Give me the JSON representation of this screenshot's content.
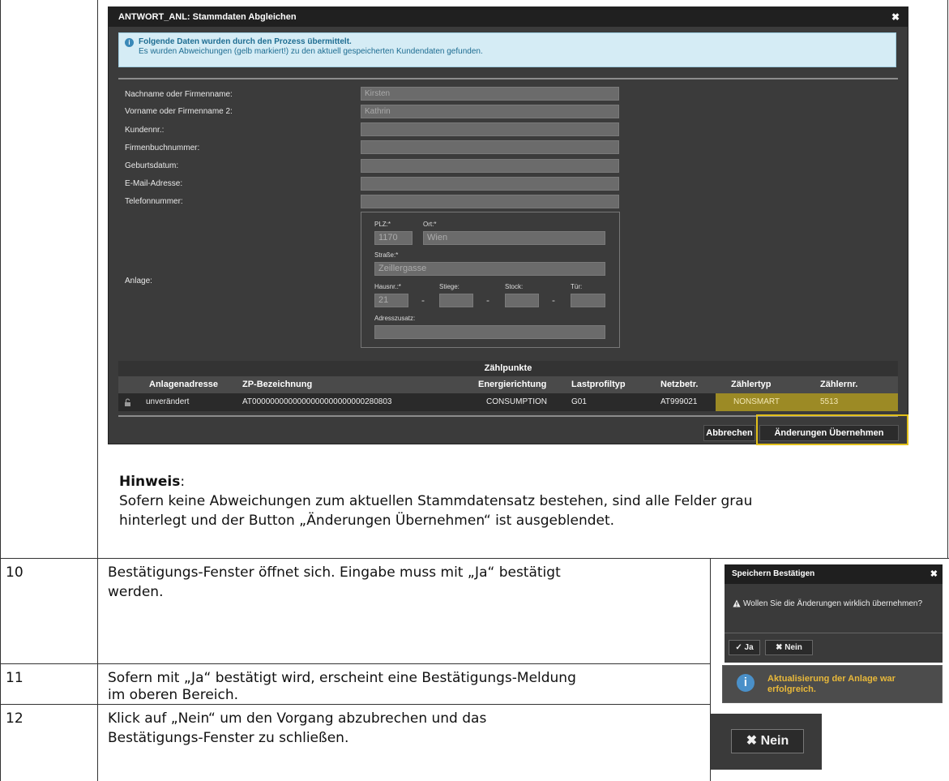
{
  "dialog": {
    "title": "ANTWORT_ANL: Stammdaten Abgleichen",
    "close_glyph": "✖",
    "info_title": "Folgende Daten wurden durch den Prozess übermittelt.",
    "info_text": "Es wurden Abweichungen (gelb markiert!) zu den aktuell gespeicherten Kundendaten gefunden.",
    "fields": [
      {
        "label": "Nachname oder Firmenname:",
        "value": "Kirsten"
      },
      {
        "label": "Vorname oder Firmenname 2:",
        "value": "Kathrin"
      },
      {
        "label": "Kundennr.:",
        "value": ""
      },
      {
        "label": "Firmenbuchnummer:",
        "value": ""
      },
      {
        "label": "Geburtsdatum:",
        "value": ""
      },
      {
        "label": "E-Mail-Adresse:",
        "value": ""
      },
      {
        "label": "Telefonnummer:",
        "value": ""
      }
    ],
    "anlage_label": "Anlage:",
    "address": {
      "plz_label": "PLZ:*",
      "plz": "1170",
      "ort_label": "Ort:*",
      "ort": "Wien",
      "strasse_label": "Straße:*",
      "strasse": "Zeillergasse",
      "hausnr_label": "Hausnr.:*",
      "hausnr": "21",
      "stiege_label": "Stiege:",
      "stiege": "",
      "stock_label": "Stock:",
      "stock": "",
      "tuer_label": "Tür:",
      "tuer": "",
      "zusatz_label": "Adresszusatz:",
      "zusatz": "",
      "dash": "-"
    },
    "zp": {
      "title": "Zählpunkte",
      "columns": [
        "Anlagenadresse",
        "ZP-Bezeichnung",
        "Energierichtung",
        "Lastprofiltyp",
        "Netzbetr.",
        "Zählertyp",
        "Zählernr."
      ],
      "row": [
        "unverändert",
        "AT0000000000000000000000000280803",
        "CONSUMPTION",
        "G01",
        "AT999021",
        "NONSMART",
        "5513"
      ]
    },
    "buttons": {
      "cancel": "Abbrechen",
      "apply": "Änderungen Übernehmen"
    }
  },
  "hinweis": {
    "heading": "Hinweis",
    "colon": ":",
    "line1": "Sofern keine Abweichungen zum aktuellen Stammdatensatz bestehen, sind alle Felder grau",
    "line2": "hinterlegt und der Button „Änderungen Übernehmen“ ist ausgeblendet."
  },
  "steps": [
    {
      "num": "10",
      "line1": "Bestätigungs-Fenster öffnet sich. Eingabe muss mit „Ja“ bestätigt",
      "line2": "werden."
    },
    {
      "num": "11",
      "line1": "Sofern mit „Ja“ bestätigt wird, erscheint eine Bestätigungs-Meldung",
      "line2": "im oberen Bereich."
    },
    {
      "num": "12",
      "line1": "Klick auf „Nein“ um den Vorgang abzubrechen und das",
      "line2": "Bestätigungs-Fenster zu schließen."
    }
  ],
  "confirm_dialog": {
    "title": "Speichern Bestätigen",
    "close_glyph": "✖",
    "message": "Wollen Sie die Änderungen wirklich übernehmen?",
    "yes": "✓ Ja",
    "no": "✖ Nein"
  },
  "success_msg": {
    "line1": "Aktualisierung der Anlage war",
    "line2": "erfolgreich."
  },
  "nein_button": "✖ Nein",
  "colors": {
    "highlight": "#9c8a25",
    "frame": "#e2c01a",
    "info_bg": "#d5ecf5",
    "success_text": "#e8b83a"
  }
}
